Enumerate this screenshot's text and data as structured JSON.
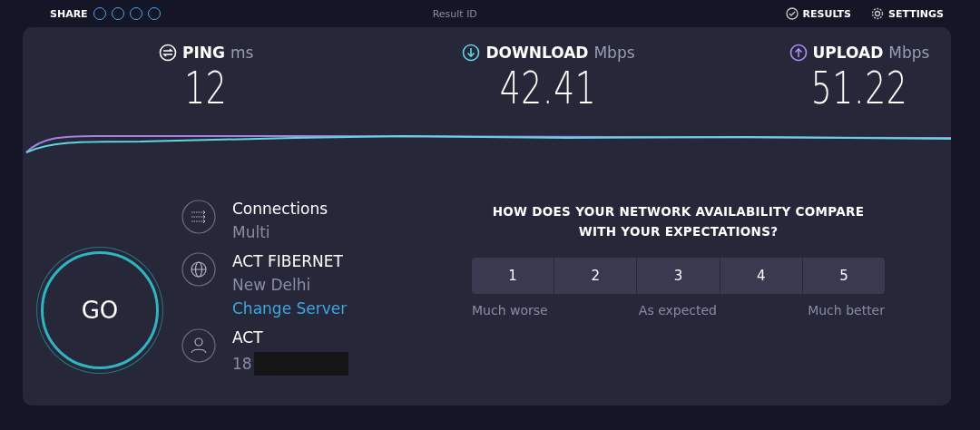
{
  "top_bar": {
    "share_label": "SHARE",
    "result_id_label": "Result ID",
    "results_label": "RESULTS",
    "settings_label": "SETTINGS"
  },
  "metrics": [
    {
      "kind": "ping",
      "label": "PING",
      "unit": "ms",
      "value": "12"
    },
    {
      "kind": "download",
      "label": "DOWNLOAD",
      "unit": "Mbps",
      "value": "42.41"
    },
    {
      "kind": "upload",
      "label": "UPLOAD",
      "unit": "Mbps",
      "value": "51.22"
    }
  ],
  "go_button": "GO",
  "info": [
    {
      "kind": "connections",
      "title": "Connections",
      "subtitle": "Multi"
    },
    {
      "kind": "server",
      "title": "ACT FIBERNET",
      "subtitle": "New Delhi",
      "link": "Change Server"
    },
    {
      "kind": "provider",
      "title": "ACT",
      "subtitle": "18",
      "redacted": true
    }
  ],
  "survey": {
    "question": "HOW DOES YOUR NETWORK AVAILABILITY COMPARE WITH YOUR EXPECTATIONS?",
    "options": [
      {
        "label": "1",
        "selected": false
      },
      {
        "label": "2",
        "selected": false
      },
      {
        "label": "3",
        "selected": false
      },
      {
        "label": "4",
        "selected": false
      },
      {
        "label": "5",
        "selected": false
      }
    ],
    "scale_labels": [
      "Much worse",
      "As expected",
      "Much better"
    ]
  }
}
